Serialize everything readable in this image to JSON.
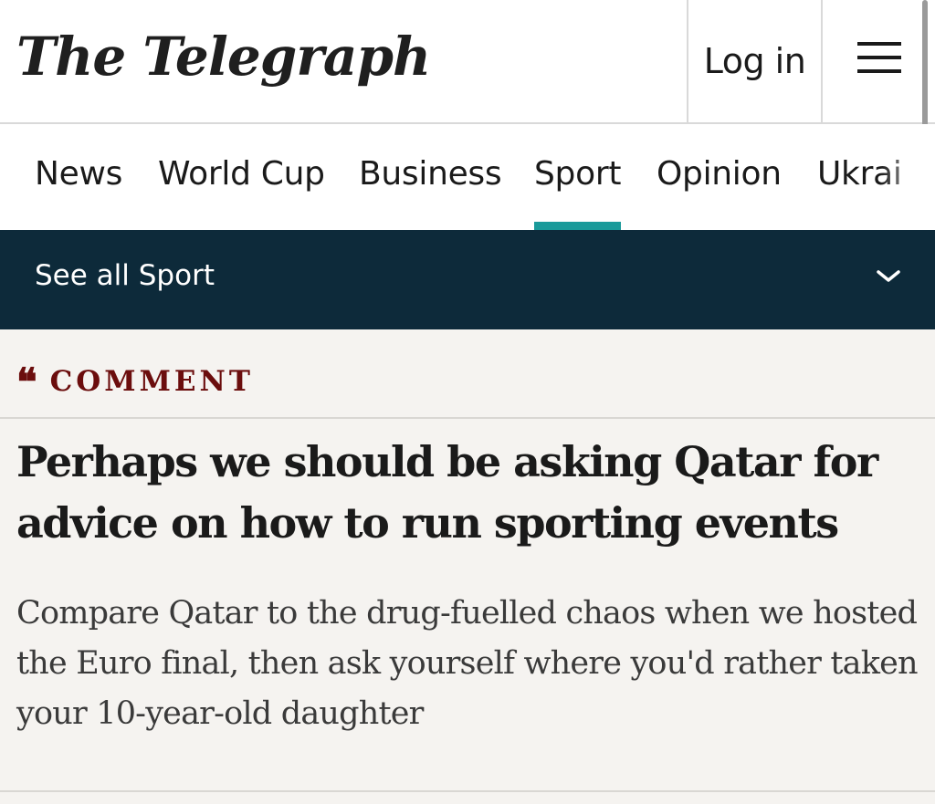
{
  "header": {
    "logo": "The Telegraph",
    "login_label": "Log in"
  },
  "nav": {
    "items": [
      {
        "label": "News"
      },
      {
        "label": "World Cup"
      },
      {
        "label": "Business"
      },
      {
        "label": "Sport"
      },
      {
        "label": "Opinion"
      },
      {
        "label": "Ukrai"
      }
    ],
    "active": "Sport"
  },
  "subbar": {
    "label": "See all Sport"
  },
  "article": {
    "section_icon": "quote-icon",
    "section_label": "COMMENT",
    "headline": "Perhaps we should be asking Qatar for advice on how to run sporting events",
    "standfirst": "Compare Qatar to the drug-fuelled chaos when we hosted the Euro final, then ask yourself where you'd rather taken your 10-year-old daughter"
  },
  "colors": {
    "accent": "#1a9a9a",
    "subbar_bg": "#0d2a3a",
    "comment": "#6b0d0d",
    "page_bg": "#f5f3f0"
  }
}
